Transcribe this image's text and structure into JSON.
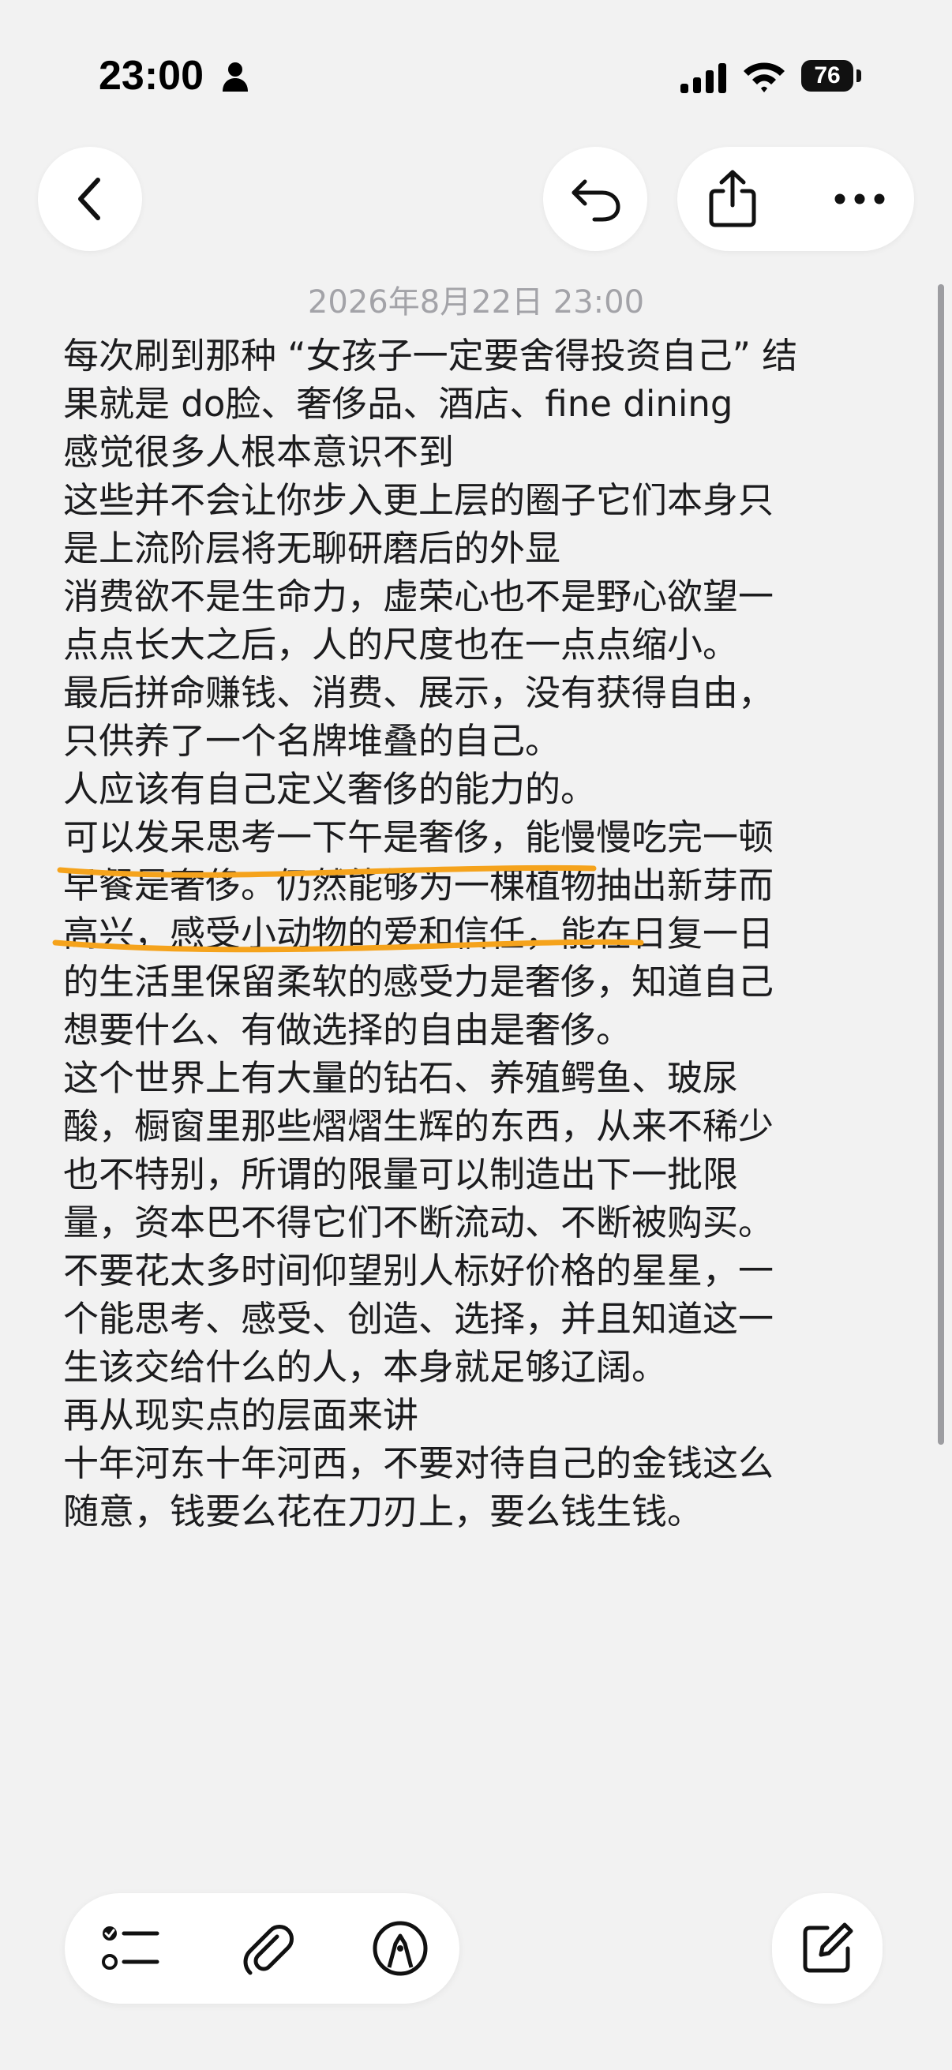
{
  "status_bar": {
    "time": "23:00",
    "battery": "76"
  },
  "note": {
    "date": "2026年8月22日 23:00",
    "lines": [
      "每次刷到那种 “女孩子一定要舍得投资自己” 结",
      "果就是 do脸、奢侈品、酒店、fine dining",
      "感觉很多人根本意识不到",
      "这些并不会让你步入更上层的圈子它们本身只",
      "是上流阶层将无聊研磨后的外显",
      "消费欲不是生命力，虚荣心也不是野心欲望一",
      "点点长大之后，人的尺度也在一点点缩小。",
      "最后拼命赚钱、消费、展示，没有获得自由，",
      "只供养了一个名牌堆叠的自己。",
      "人应该有自己定义奢侈的能力的。",
      "可以发呆思考一下午是奢侈，能慢慢吃完一顿",
      "早餐是奢侈。仍然能够为一棵植物抽出新芽而",
      "高兴，感受小动物的爱和信任，能在日复一日",
      "的生活里保留柔软的感受力是奢侈，知道自己",
      "想要什么、有做选择的自由是奢侈。",
      "这个世界上有大量的钻石、养殖鳄鱼、玻尿",
      "酸，橱窗里那些熠熠生辉的东西，从来不稀少",
      "也不特别，所谓的限量可以制造出下一批限",
      "量，资本巴不得它们不断流动、不断被购买。",
      "不要花太多时间仰望别人标好价格的星星，一",
      "个能思考、感受、创造、选择，并且知道这一",
      "生该交给什么的人，本身就足够辽阔。",
      "再从现实点的层面来讲",
      "十年河东十年河西，不要对待自己的金钱这么",
      "随意，钱要么花在刀刃上，要么钱生钱。"
    ]
  },
  "colors": {
    "background": "#f2f2f2",
    "highlight_underline": "#f5a31c",
    "date_text": "#a3a3a8"
  },
  "icons": {
    "back": "chevron-left-icon",
    "undo": "undo-icon",
    "share": "share-icon",
    "more": "more-icon",
    "checklist": "checklist-icon",
    "attach": "paperclip-icon",
    "markup": "markup-pen-icon",
    "compose": "compose-icon"
  }
}
